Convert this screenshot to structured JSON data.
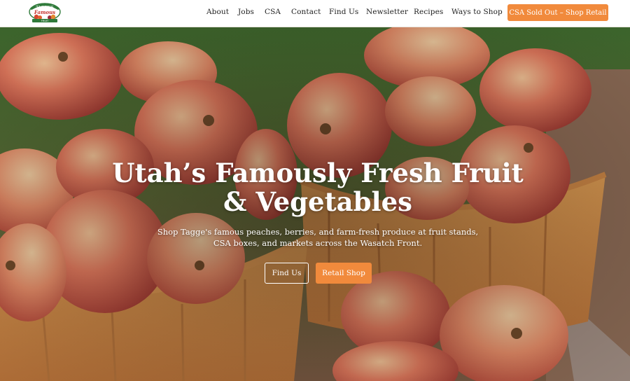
{
  "header": {
    "logo_text": "Tagge's Famous Fruit",
    "nav": [
      {
        "label": "About"
      },
      {
        "label": "Jobs"
      },
      {
        "label": "CSA"
      },
      {
        "label": "Contact"
      },
      {
        "label": "Find Us"
      },
      {
        "label": "Newsletter"
      },
      {
        "label": "Recipes"
      },
      {
        "label": "Ways to Shop"
      }
    ],
    "cta_label": "CSA Sold Out – Shop Retail"
  },
  "hero": {
    "title": "Utah’s Famously Fresh Fruit & Vegetables",
    "subtitle": "Shop Tagge's famous peaches, berries, and farm-fresh produce at fruit stands, CSA boxes, and markets across the Wasatch Front.",
    "primary_button": "Find Us",
    "secondary_button": "Retail Shop"
  },
  "colors": {
    "accent": "#f18a3c",
    "logo_green": "#2f7a3a",
    "logo_red": "#c8332e"
  },
  "icons": {
    "logo": "tagges-famous-fruit-logo"
  }
}
